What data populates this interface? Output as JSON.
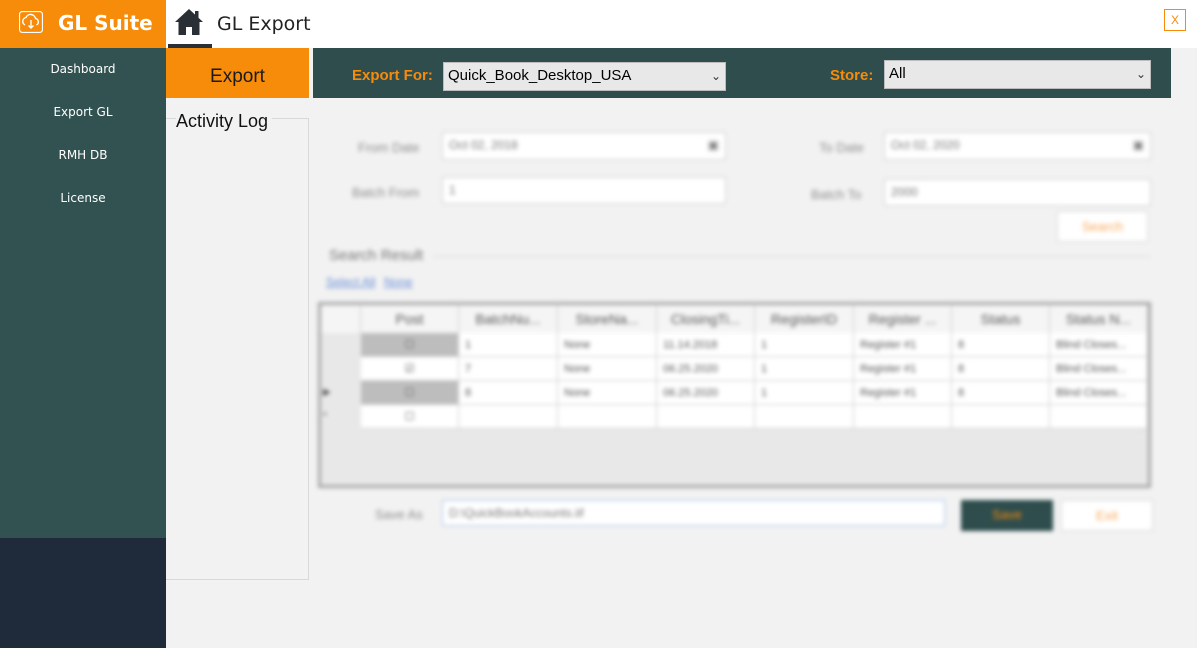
{
  "app": {
    "title": "GL Suite",
    "page_title": "GL Export",
    "close_label": "X"
  },
  "sidebar": {
    "items": [
      {
        "label": "Dashboard"
      },
      {
        "label": "Export GL"
      },
      {
        "label": "RMH DB"
      },
      {
        "label": "License"
      }
    ]
  },
  "tabs": {
    "export": "Export",
    "activity_log": "Activity Log"
  },
  "topbar": {
    "export_for_label": "Export For:",
    "export_for_value": "Quick_Book_Desktop_USA",
    "store_label": "Store:",
    "store_value": "All"
  },
  "filters": {
    "from_date_label": "From Date",
    "from_date_value": "Oct 02, 2018",
    "to_date_label": "To Date",
    "to_date_value": "Oct 02, 2020",
    "batch_from_label": "Batch From",
    "batch_from_value": "1",
    "batch_to_label": "Batch To",
    "batch_to_value": "2000",
    "search_label": "Search"
  },
  "results": {
    "title": "Search Result",
    "select_all": "Select All",
    "none": "None",
    "columns": [
      "Post",
      "BatchNu...",
      "StoreNa...",
      "ClosingTi...",
      "RegisterID",
      "Register ...",
      "Status",
      "Status N..."
    ],
    "rows": [
      {
        "marker": "",
        "cells": [
          "1",
          "None",
          "11.14.2018",
          "1",
          "Register #1",
          "8",
          "Blind Closes..."
        ]
      },
      {
        "marker": "",
        "cells": [
          "7",
          "None",
          "06.25.2020",
          "1",
          "Register #1",
          "8",
          "Blind Closes..."
        ]
      },
      {
        "marker": "▶",
        "cells": [
          "8",
          "None",
          "06.25.2020",
          "1",
          "Register #1",
          "8",
          "Blind Closes..."
        ]
      },
      {
        "marker": "*",
        "cells": [
          "",
          "",
          "",
          "",
          "",
          "",
          ""
        ]
      }
    ]
  },
  "save": {
    "save_as_label": "Save As",
    "path_value": "D:\\QuickBookAccounts.iif",
    "save_button": "Save",
    "exit_button": "Exit"
  },
  "colors": {
    "accent": "#f78c0a",
    "sidebar": "#315251",
    "topbar": "#2f4d4d",
    "sidebar_bottom": "#1f2b3a"
  }
}
